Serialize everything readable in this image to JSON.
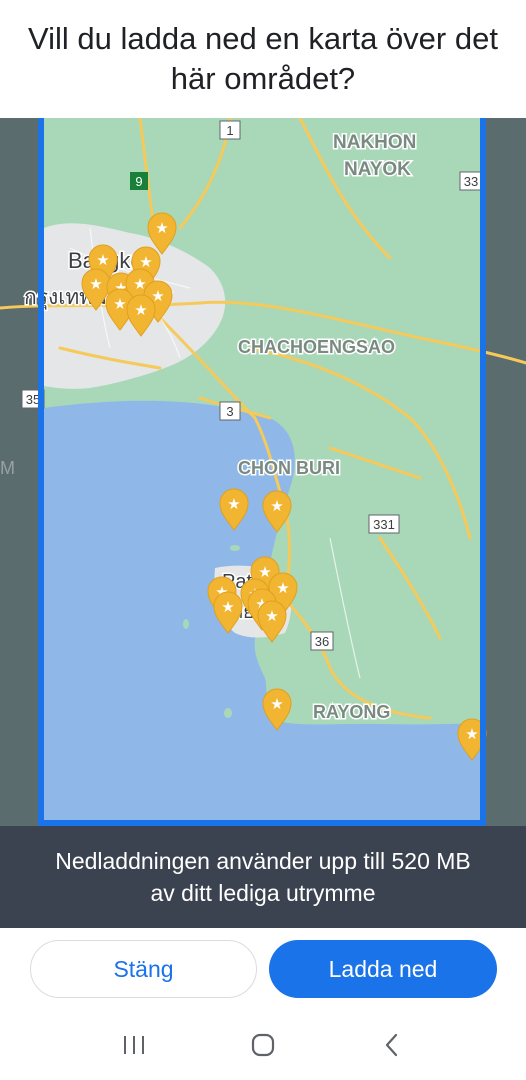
{
  "dialog": {
    "title": "Vill du ladda ned en karta över det här området?",
    "storage_note": "Nedladdningen använder upp till 520 MB av ditt lediga utrymme"
  },
  "map": {
    "labels": {
      "nakhon": "NAKHON",
      "nayok": "NAYOK",
      "bangkok": "Bangkok",
      "bangkok_thai": "กรุงเทพมหานคร",
      "chachoengsao": "CHACHOENGSAO",
      "chon_buri": "CHON BURI",
      "pattaya": "Pattaya",
      "pattaya_thai": "พัทยา",
      "rayong": "RAYONG",
      "edge_m": "M"
    },
    "road_shields": {
      "r1": "1",
      "r9": "9",
      "r33": "33",
      "r35": "35",
      "r3": "3",
      "r331": "331",
      "r36": "36"
    }
  },
  "actions": {
    "close_label": "Stäng",
    "download_label": "Ladda ned"
  },
  "colors": {
    "accent": "#1a73e8",
    "water": "#8fb8e8",
    "land": "#a9d8b8",
    "city": "#e8e9ea",
    "road": "#f5c95a",
    "pin": "#f2b531",
    "overlay": "#3c4350"
  },
  "icons": {
    "pin": "starred-place-pin-icon",
    "recents": "recent-apps-icon",
    "home": "home-icon",
    "back": "back-icon"
  }
}
